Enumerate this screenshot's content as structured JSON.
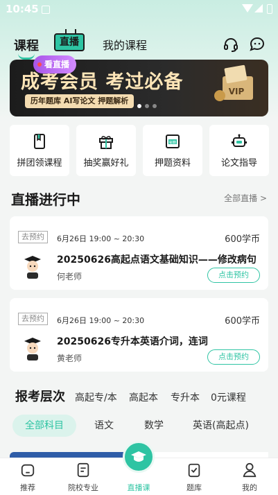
{
  "status_bar": {
    "time": "10:45"
  },
  "nav": {
    "tabs": [
      {
        "label": "课程"
      },
      {
        "label": "直播"
      },
      {
        "label": "我的课程"
      }
    ]
  },
  "banner": {
    "headline": "成考会员 考过必备",
    "subline": "历年题库  AI写论文  押题解析",
    "vip_text": "VIP",
    "live_badge": "看直播"
  },
  "quick_entries": [
    {
      "label": "拼团领课程",
      "icon": "book-icon"
    },
    {
      "label": "抽奖赢好礼",
      "icon": "gift-icon"
    },
    {
      "label": "押题资料",
      "icon": "document-icon",
      "icon_text": "秘籍"
    },
    {
      "label": "论文指导",
      "icon": "robot-icon"
    }
  ],
  "live_section": {
    "title": "直播进行中",
    "more": "全部直播 >"
  },
  "live_cards": [
    {
      "tag": "去预约",
      "when": "6月26日  19:00 ~ 20:30",
      "price": "600学币",
      "title": "20250626高起点语文基础知识——修改病句",
      "teacher": "何老师",
      "action": "点击预约"
    },
    {
      "tag": "去预约",
      "when": "6月26日  19:00 ~ 20:30",
      "price": "600学币",
      "title": "20250626专升本英语介词，连词",
      "teacher": "黄老师",
      "action": "点击预约"
    }
  ],
  "levels": {
    "title": "报考层次",
    "items": [
      "高起专/本",
      "高起本",
      "专升本",
      "0元课程"
    ]
  },
  "subjects": [
    "全部科目",
    "语文",
    "数学",
    "英语(高起点)"
  ],
  "tabbar": [
    {
      "label": "推荐",
      "icon": "home-icon"
    },
    {
      "label": "院校专业",
      "icon": "school-icon"
    },
    {
      "label": "直播课",
      "icon": "graduation-cap-icon"
    },
    {
      "label": "题库",
      "icon": "clipboard-check-icon"
    },
    {
      "label": "我的",
      "icon": "user-icon"
    }
  ],
  "colors": {
    "accent": "#2ec4a3",
    "banner_gold": "#ffe6b8",
    "live_badge": "#b86bf0"
  }
}
